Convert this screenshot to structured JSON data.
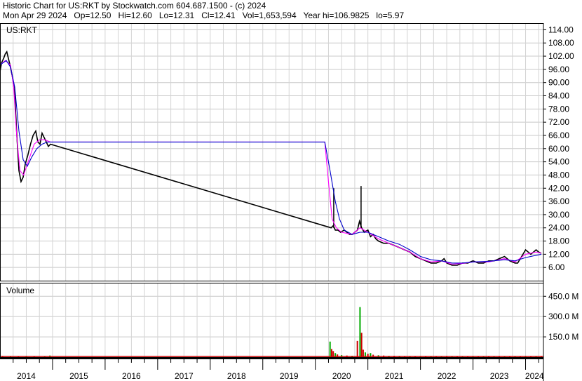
{
  "header": {
    "line1": "Historic Chart for US:RKT by Stockwatch.com 604.687.1500 - (c) 2024",
    "line2": "Mon Apr 29 2024   Op=12.50   Hi=12.60   Lo=12.31   Cl=12.41   Vol=1,653,594   Year hi=106.9825   lo=5.97"
  },
  "chart_data": [
    {
      "type": "line",
      "title": "US:RKT",
      "y_axis_position": "right",
      "ylim": [
        0,
        117
      ],
      "yticks": [
        6,
        12,
        18,
        24,
        30,
        36,
        42,
        48,
        54,
        60,
        66,
        72,
        78,
        84,
        90,
        96,
        102,
        108,
        114
      ],
      "ytick_labels": [
        "6.00",
        "12.00",
        "18.00",
        "24.00",
        "30.00",
        "36.00",
        "42.00",
        "48.00",
        "54.00",
        "60.00",
        "66.00",
        "72.00",
        "78.00",
        "84.00",
        "90.00",
        "96.00",
        "102.00",
        "108.00",
        "114.00"
      ],
      "xlim": [
        2014.0,
        2024.34
      ],
      "xticks": [
        2014,
        2015,
        2016,
        2017,
        2018,
        2019,
        2020,
        2021,
        2022,
        2023,
        2024
      ],
      "xtick_labels": [
        "2014",
        "2015",
        "2016",
        "2017",
        "2018",
        "2019",
        "2020",
        "2021",
        "2022",
        "2023",
        "2024"
      ],
      "grid": true,
      "series": [
        {
          "style": "price",
          "color": "#000000",
          "points": [
            [
              2014.0,
              95
            ],
            [
              2014.03,
              99
            ],
            [
              2014.07,
              101
            ],
            [
              2014.1,
              103
            ],
            [
              2014.13,
              104
            ],
            [
              2014.17,
              100
            ],
            [
              2014.2,
              97
            ],
            [
              2014.24,
              92
            ],
            [
              2014.28,
              85
            ],
            [
              2014.32,
              66
            ],
            [
              2014.36,
              50
            ],
            [
              2014.4,
              45
            ],
            [
              2014.44,
              47
            ],
            [
              2014.48,
              53
            ],
            [
              2014.53,
              57
            ],
            [
              2014.58,
              62
            ],
            [
              2014.63,
              66
            ],
            [
              2014.68,
              68
            ],
            [
              2014.72,
              63
            ],
            [
              2014.76,
              62
            ],
            [
              2014.8,
              67
            ],
            [
              2014.86,
              64
            ],
            [
              2014.92,
              61
            ],
            [
              2014.96,
              62
            ],
            [
              2020.3,
              24
            ],
            [
              2020.34,
              25
            ],
            [
              2020.38,
              23
            ],
            [
              2020.43,
              23
            ],
            [
              2020.48,
              22
            ],
            [
              2020.55,
              23
            ],
            [
              2020.6,
              22
            ],
            [
              2020.65,
              21
            ],
            [
              2020.7,
              21
            ],
            [
              2020.75,
              22
            ],
            [
              2020.8,
              23
            ],
            [
              2020.84,
              27
            ],
            [
              2020.88,
              24
            ],
            [
              2020.93,
              22
            ],
            [
              2021.0,
              23
            ],
            [
              2021.05,
              20
            ],
            [
              2021.1,
              21
            ],
            [
              2021.15,
              19
            ],
            [
              2021.2,
              18
            ],
            [
              2021.3,
              17
            ],
            [
              2021.4,
              17
            ],
            [
              2021.5,
              16
            ],
            [
              2021.6,
              15
            ],
            [
              2021.7,
              14
            ],
            [
              2021.8,
              13
            ],
            [
              2021.9,
              11
            ],
            [
              2022.0,
              10
            ],
            [
              2022.1,
              9
            ],
            [
              2022.2,
              8
            ],
            [
              2022.3,
              8
            ],
            [
              2022.4,
              9
            ],
            [
              2022.45,
              10
            ],
            [
              2022.5,
              8
            ],
            [
              2022.6,
              7
            ],
            [
              2022.7,
              7
            ],
            [
              2022.8,
              8
            ],
            [
              2022.9,
              8
            ],
            [
              2023.0,
              9
            ],
            [
              2023.1,
              8
            ],
            [
              2023.2,
              8
            ],
            [
              2023.3,
              9
            ],
            [
              2023.4,
              9
            ],
            [
              2023.5,
              10
            ],
            [
              2023.6,
              11
            ],
            [
              2023.7,
              9
            ],
            [
              2023.8,
              8
            ],
            [
              2023.85,
              8
            ],
            [
              2023.9,
              10
            ],
            [
              2023.95,
              12
            ],
            [
              2024.0,
              14
            ],
            [
              2024.05,
              13
            ],
            [
              2024.1,
              12
            ],
            [
              2024.15,
              13
            ],
            [
              2024.2,
              14
            ],
            [
              2024.25,
              13
            ],
            [
              2024.3,
              12.4
            ]
          ],
          "spikes": [
            [
              2020.35,
              42
            ],
            [
              2020.87,
              43
            ]
          ]
        },
        {
          "style": "moving-average-short",
          "color": "#ff00ff",
          "points": [
            [
              2014.0,
              98
            ],
            [
              2014.1,
              100
            ],
            [
              2014.2,
              98
            ],
            [
              2014.26,
              88
            ],
            [
              2014.32,
              65
            ],
            [
              2014.38,
              50
            ],
            [
              2014.45,
              48
            ],
            [
              2014.55,
              55
            ],
            [
              2014.65,
              62
            ],
            [
              2014.75,
              64
            ],
            [
              2014.85,
              64
            ],
            [
              2014.96,
              63
            ],
            [
              2020.18,
              63
            ],
            [
              2020.25,
              45
            ],
            [
              2020.32,
              28
            ],
            [
              2020.4,
              24
            ],
            [
              2020.5,
              22
            ],
            [
              2020.7,
              21
            ],
            [
              2020.85,
              24
            ],
            [
              2021.0,
              22
            ],
            [
              2021.2,
              19
            ],
            [
              2021.4,
              17
            ],
            [
              2021.6,
              15
            ],
            [
              2021.8,
              13
            ],
            [
              2022.0,
              10
            ],
            [
              2022.2,
              8.5
            ],
            [
              2022.4,
              9
            ],
            [
              2022.6,
              7.5
            ],
            [
              2022.8,
              7.8
            ],
            [
              2023.0,
              8.5
            ],
            [
              2023.3,
              8.5
            ],
            [
              2023.6,
              10
            ],
            [
              2023.8,
              8.5
            ],
            [
              2024.0,
              12
            ],
            [
              2024.2,
              13
            ],
            [
              2024.3,
              12.5
            ]
          ]
        },
        {
          "style": "moving-average-long",
          "color": "#0000cc",
          "points": [
            [
              2014.0,
              98
            ],
            [
              2014.12,
              100
            ],
            [
              2014.2,
              97
            ],
            [
              2014.28,
              88
            ],
            [
              2014.36,
              68
            ],
            [
              2014.44,
              55
            ],
            [
              2014.52,
              52
            ],
            [
              2014.6,
              56
            ],
            [
              2014.7,
              60
            ],
            [
              2014.8,
              62
            ],
            [
              2014.9,
              63
            ],
            [
              2014.96,
              63
            ],
            [
              2020.18,
              63
            ],
            [
              2020.28,
              50
            ],
            [
              2020.38,
              36
            ],
            [
              2020.46,
              28
            ],
            [
              2020.55,
              23
            ],
            [
              2020.7,
              21
            ],
            [
              2020.85,
              22
            ],
            [
              2021.0,
              22
            ],
            [
              2021.2,
              20
            ],
            [
              2021.4,
              18
            ],
            [
              2021.6,
              16.5
            ],
            [
              2021.8,
              14
            ],
            [
              2022.0,
              11
            ],
            [
              2022.2,
              9.5
            ],
            [
              2022.4,
              9
            ],
            [
              2022.6,
              8
            ],
            [
              2022.8,
              8
            ],
            [
              2023.0,
              8.5
            ],
            [
              2023.3,
              8.8
            ],
            [
              2023.6,
              9.5
            ],
            [
              2023.8,
              9
            ],
            [
              2024.0,
              10.5
            ],
            [
              2024.2,
              11.5
            ],
            [
              2024.3,
              12
            ]
          ]
        }
      ]
    },
    {
      "type": "bar",
      "title": "Volume",
      "y_axis_position": "right",
      "ylim": [
        0,
        550
      ],
      "yticks": [
        150,
        300,
        450
      ],
      "ytick_labels": [
        "150.0 M",
        "300.0 M",
        "450.0 M"
      ],
      "xlim": [
        2014.0,
        2024.34
      ],
      "bars": [
        {
          "x": 2014.05,
          "v": 4,
          "color": "#cc0000"
        },
        {
          "x": 2014.2,
          "v": 3,
          "color": "#00aa00"
        },
        {
          "x": 2014.35,
          "v": 5,
          "color": "#cc0000"
        },
        {
          "x": 2014.5,
          "v": 3,
          "color": "#00aa00"
        },
        {
          "x": 2014.65,
          "v": 4,
          "color": "#cc0000"
        },
        {
          "x": 2014.85,
          "v": 3,
          "color": "#00aa00"
        },
        {
          "x": 2014.95,
          "v": 12,
          "color": "#00aa00"
        },
        {
          "x": 2020.28,
          "v": 115,
          "color": "#00aa00"
        },
        {
          "x": 2020.31,
          "v": 60,
          "color": "#cc0000"
        },
        {
          "x": 2020.34,
          "v": 45,
          "color": "#cc0000"
        },
        {
          "x": 2020.38,
          "v": 30,
          "color": "#00aa00"
        },
        {
          "x": 2020.42,
          "v": 20,
          "color": "#cc0000"
        },
        {
          "x": 2020.5,
          "v": 15,
          "color": "#00aa00"
        },
        {
          "x": 2020.6,
          "v": 12,
          "color": "#cc0000"
        },
        {
          "x": 2020.7,
          "v": 10,
          "color": "#00aa00"
        },
        {
          "x": 2020.8,
          "v": 120,
          "color": "#cc0000"
        },
        {
          "x": 2020.85,
          "v": 370,
          "color": "#00aa00"
        },
        {
          "x": 2020.88,
          "v": 180,
          "color": "#cc0000"
        },
        {
          "x": 2020.91,
          "v": 55,
          "color": "#cc0000"
        },
        {
          "x": 2020.95,
          "v": 35,
          "color": "#00aa00"
        },
        {
          "x": 2021.0,
          "v": 25,
          "color": "#cc0000"
        },
        {
          "x": 2021.05,
          "v": 30,
          "color": "#00aa00"
        },
        {
          "x": 2021.1,
          "v": 18,
          "color": "#cc0000"
        },
        {
          "x": 2021.2,
          "v": 14,
          "color": "#00aa00"
        },
        {
          "x": 2021.3,
          "v": 12,
          "color": "#cc0000"
        },
        {
          "x": 2021.4,
          "v": 10,
          "color": "#00aa00"
        },
        {
          "x": 2021.5,
          "v": 10,
          "color": "#cc0000"
        },
        {
          "x": 2021.6,
          "v": 9,
          "color": "#00aa00"
        },
        {
          "x": 2021.7,
          "v": 8,
          "color": "#cc0000"
        },
        {
          "x": 2021.8,
          "v": 8,
          "color": "#00aa00"
        },
        {
          "x": 2021.9,
          "v": 7,
          "color": "#cc0000"
        },
        {
          "x": 2022.0,
          "v": 7,
          "color": "#00aa00"
        },
        {
          "x": 2022.1,
          "v": 6,
          "color": "#cc0000"
        },
        {
          "x": 2022.2,
          "v": 6,
          "color": "#00aa00"
        },
        {
          "x": 2022.3,
          "v": 6,
          "color": "#cc0000"
        },
        {
          "x": 2022.4,
          "v": 5,
          "color": "#00aa00"
        },
        {
          "x": 2022.5,
          "v": 5,
          "color": "#cc0000"
        },
        {
          "x": 2022.6,
          "v": 5,
          "color": "#00aa00"
        },
        {
          "x": 2022.7,
          "v": 5,
          "color": "#cc0000"
        },
        {
          "x": 2022.8,
          "v": 5,
          "color": "#00aa00"
        },
        {
          "x": 2022.9,
          "v": 5,
          "color": "#cc0000"
        },
        {
          "x": 2023.0,
          "v": 5,
          "color": "#00aa00"
        },
        {
          "x": 2023.1,
          "v": 5,
          "color": "#cc0000"
        },
        {
          "x": 2023.2,
          "v": 5,
          "color": "#00aa00"
        },
        {
          "x": 2023.3,
          "v": 5,
          "color": "#cc0000"
        },
        {
          "x": 2023.4,
          "v": 5,
          "color": "#00aa00"
        },
        {
          "x": 2023.5,
          "v": 5,
          "color": "#cc0000"
        },
        {
          "x": 2023.6,
          "v": 5,
          "color": "#00aa00"
        },
        {
          "x": 2023.7,
          "v": 5,
          "color": "#cc0000"
        },
        {
          "x": 2023.8,
          "v": 5,
          "color": "#00aa00"
        },
        {
          "x": 2023.9,
          "v": 6,
          "color": "#cc0000"
        },
        {
          "x": 2024.0,
          "v": 8,
          "color": "#00aa00"
        },
        {
          "x": 2024.1,
          "v": 6,
          "color": "#cc0000"
        },
        {
          "x": 2024.2,
          "v": 5,
          "color": "#00aa00"
        },
        {
          "x": 2024.3,
          "v": 5,
          "color": "#cc0000"
        }
      ]
    }
  ]
}
